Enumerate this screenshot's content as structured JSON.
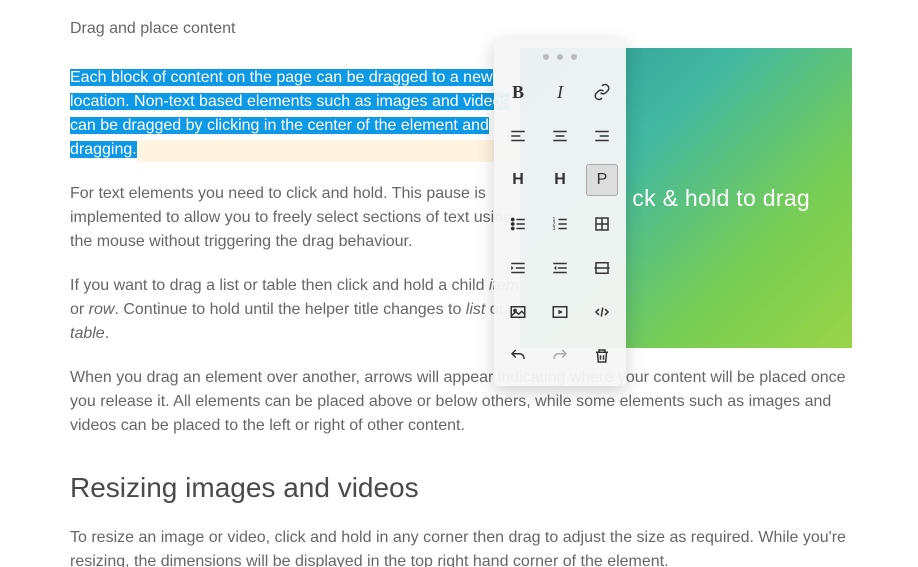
{
  "intro": "Drag and place content",
  "para1_highlighted": "Each block of content on the page can be dragged to a new location. Non-text based elements such as images and videos can be dragged by clicking in the center of the element and dragging.",
  "para2": "For text elements you need to click and hold. This pause is implemented to allow you to freely select sections of text using the mouse without triggering the drag behaviour.",
  "para3_a": "If you want to drag a list or table then click and hold a child ",
  "para3_item": "item",
  "para3_b": " or ",
  "para3_row": "row",
  "para3_c": ". Continue to hold until the helper title changes to ",
  "para3_list": "list",
  "para3_d": " or ",
  "para3_table": "table",
  "para3_e": ".",
  "para4": "When you drag an element over another, arrows will appear indicating where your content will be placed once you release it. All elements can be placed above or below others, while some elements such as images and videos can be placed to the left or right of other content.",
  "section2_title": "Resizing images and videos",
  "para5": "To resize an image or video, click and hold in any corner then drag to adjust the size as required. While you're resizing, the dimensions will be displayed in the top right hand corner of the element.",
  "gradient_label": "ck & hold to drag",
  "toolbar": {
    "bold": "B",
    "italic": "I",
    "h1": "H",
    "h2": "H",
    "p": "P"
  }
}
